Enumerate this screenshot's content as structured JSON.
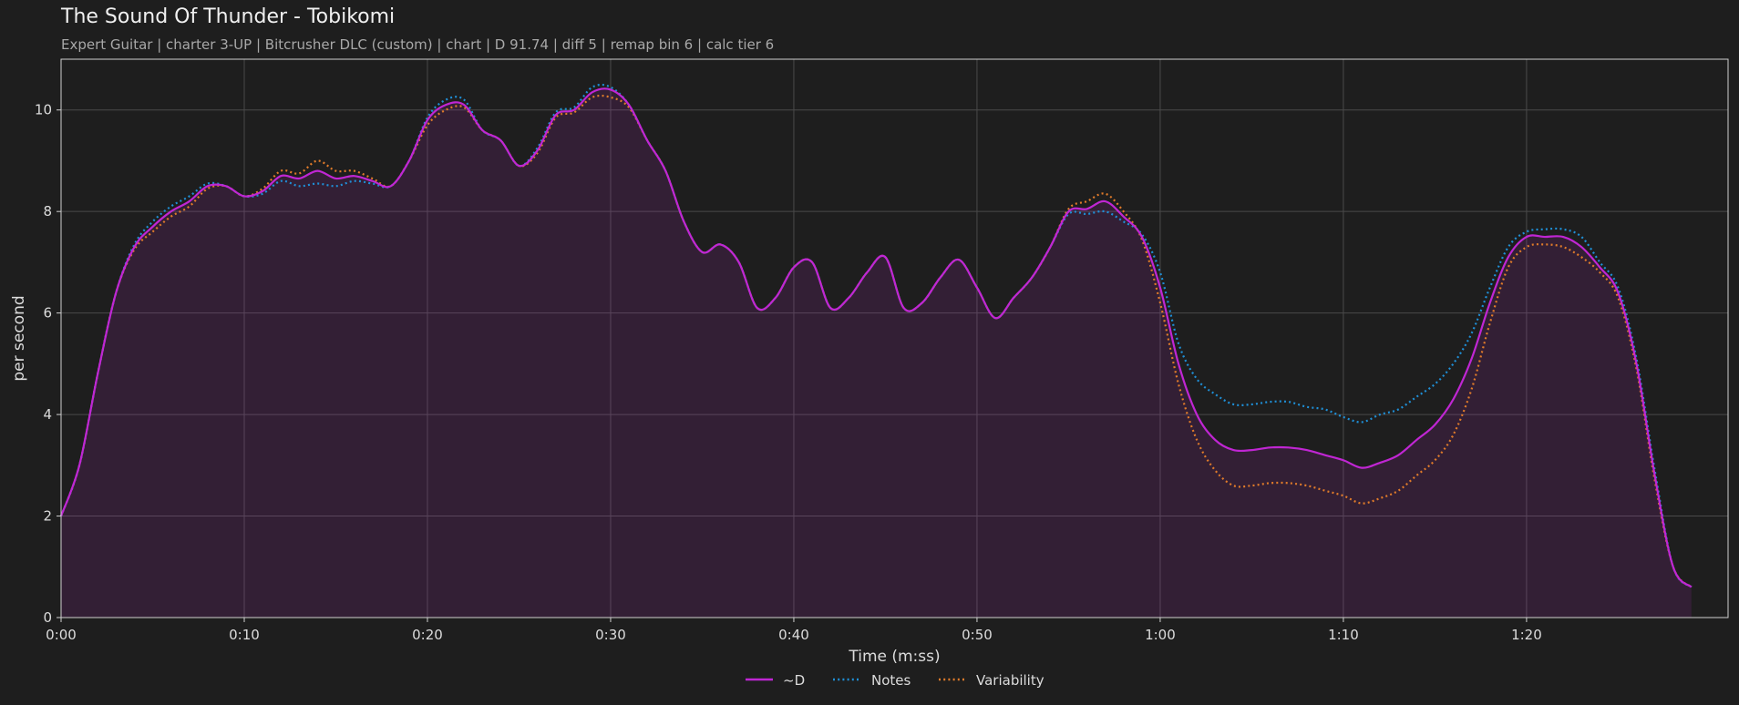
{
  "header": {
    "title": "The Sound Of Thunder - Tobikomi",
    "subtitle": "Expert Guitar  |  charter 3-UP  |  Bitcrusher DLC (custom)  |  chart  |  D 91.74  |  diff 5  |  remap bin 6  |  calc tier 6"
  },
  "chart_data": {
    "type": "line",
    "xlabel": "Time (m:ss)",
    "ylabel": "per second",
    "xlim": [
      0,
      91
    ],
    "ylim": [
      0,
      11
    ],
    "grid": true,
    "legend_position": "bottom-center",
    "x_ticks": [
      {
        "value": 0,
        "label": "0:00"
      },
      {
        "value": 10,
        "label": "0:10"
      },
      {
        "value": 20,
        "label": "0:20"
      },
      {
        "value": 30,
        "label": "0:30"
      },
      {
        "value": 40,
        "label": "0:40"
      },
      {
        "value": 50,
        "label": "0:50"
      },
      {
        "value": 60,
        "label": "1:00"
      },
      {
        "value": 70,
        "label": "1:10"
      },
      {
        "value": 80,
        "label": "1:20"
      }
    ],
    "y_ticks": [
      0,
      2,
      4,
      6,
      8,
      10
    ],
    "series": [
      {
        "name": "~D",
        "color": "#c026d3",
        "style": "solid",
        "fill": true,
        "points": [
          [
            0,
            2.0
          ],
          [
            1,
            3.0
          ],
          [
            2,
            4.8
          ],
          [
            3,
            6.4
          ],
          [
            4,
            7.3
          ],
          [
            5,
            7.7
          ],
          [
            6,
            8.0
          ],
          [
            7,
            8.2
          ],
          [
            8,
            8.5
          ],
          [
            9,
            8.5
          ],
          [
            10,
            8.3
          ],
          [
            11,
            8.4
          ],
          [
            12,
            8.7
          ],
          [
            13,
            8.65
          ],
          [
            14,
            8.8
          ],
          [
            15,
            8.65
          ],
          [
            16,
            8.7
          ],
          [
            17,
            8.6
          ],
          [
            18,
            8.5
          ],
          [
            19,
            9.0
          ],
          [
            20,
            9.8
          ],
          [
            21,
            10.1
          ],
          [
            22,
            10.1
          ],
          [
            23,
            9.6
          ],
          [
            24,
            9.4
          ],
          [
            25,
            8.9
          ],
          [
            26,
            9.2
          ],
          [
            27,
            9.9
          ],
          [
            28,
            10.0
          ],
          [
            29,
            10.35
          ],
          [
            30,
            10.4
          ],
          [
            31,
            10.1
          ],
          [
            32,
            9.4
          ],
          [
            33,
            8.8
          ],
          [
            34,
            7.8
          ],
          [
            35,
            7.2
          ],
          [
            36,
            7.35
          ],
          [
            37,
            7.0
          ],
          [
            38,
            6.1
          ],
          [
            39,
            6.3
          ],
          [
            40,
            6.9
          ],
          [
            41,
            7.0
          ],
          [
            42,
            6.1
          ],
          [
            43,
            6.3
          ],
          [
            44,
            6.8
          ],
          [
            45,
            7.1
          ],
          [
            46,
            6.1
          ],
          [
            47,
            6.2
          ],
          [
            48,
            6.7
          ],
          [
            49,
            7.05
          ],
          [
            50,
            6.5
          ],
          [
            51,
            5.9
          ],
          [
            52,
            6.3
          ],
          [
            53,
            6.7
          ],
          [
            54,
            7.3
          ],
          [
            55,
            8.0
          ],
          [
            56,
            8.05
          ],
          [
            57,
            8.2
          ],
          [
            58,
            7.9
          ],
          [
            59,
            7.5
          ],
          [
            60,
            6.5
          ],
          [
            61,
            5.0
          ],
          [
            62,
            4.0
          ],
          [
            63,
            3.5
          ],
          [
            64,
            3.3
          ],
          [
            65,
            3.3
          ],
          [
            66,
            3.35
          ],
          [
            67,
            3.35
          ],
          [
            68,
            3.3
          ],
          [
            69,
            3.2
          ],
          [
            70,
            3.1
          ],
          [
            71,
            2.95
          ],
          [
            72,
            3.05
          ],
          [
            73,
            3.2
          ],
          [
            74,
            3.5
          ],
          [
            75,
            3.8
          ],
          [
            76,
            4.3
          ],
          [
            77,
            5.1
          ],
          [
            78,
            6.2
          ],
          [
            79,
            7.1
          ],
          [
            80,
            7.5
          ],
          [
            81,
            7.5
          ],
          [
            82,
            7.5
          ],
          [
            83,
            7.3
          ],
          [
            84,
            6.9
          ],
          [
            85,
            6.4
          ],
          [
            86,
            5.0
          ],
          [
            87,
            2.8
          ],
          [
            88,
            1.0
          ],
          [
            89,
            0.6
          ]
        ]
      },
      {
        "name": "Notes",
        "color": "#1f8fd6",
        "style": "dotted",
        "fill": false,
        "points": [
          [
            0,
            2.0
          ],
          [
            1,
            3.0
          ],
          [
            2,
            4.8
          ],
          [
            3,
            6.4
          ],
          [
            4,
            7.35
          ],
          [
            5,
            7.8
          ],
          [
            6,
            8.1
          ],
          [
            7,
            8.3
          ],
          [
            8,
            8.55
          ],
          [
            9,
            8.5
          ],
          [
            10,
            8.3
          ],
          [
            11,
            8.35
          ],
          [
            12,
            8.6
          ],
          [
            13,
            8.5
          ],
          [
            14,
            8.55
          ],
          [
            15,
            8.5
          ],
          [
            16,
            8.6
          ],
          [
            17,
            8.55
          ],
          [
            18,
            8.5
          ],
          [
            19,
            9.0
          ],
          [
            20,
            9.85
          ],
          [
            21,
            10.2
          ],
          [
            22,
            10.2
          ],
          [
            23,
            9.6
          ],
          [
            24,
            9.4
          ],
          [
            25,
            8.9
          ],
          [
            26,
            9.25
          ],
          [
            27,
            9.95
          ],
          [
            28,
            10.05
          ],
          [
            29,
            10.45
          ],
          [
            30,
            10.45
          ],
          [
            31,
            10.1
          ],
          [
            32,
            9.4
          ],
          [
            33,
            8.8
          ],
          [
            34,
            7.8
          ],
          [
            35,
            7.2
          ],
          [
            36,
            7.35
          ],
          [
            37,
            7.0
          ],
          [
            38,
            6.1
          ],
          [
            39,
            6.3
          ],
          [
            40,
            6.9
          ],
          [
            41,
            7.0
          ],
          [
            42,
            6.1
          ],
          [
            43,
            6.3
          ],
          [
            44,
            6.8
          ],
          [
            45,
            7.1
          ],
          [
            46,
            6.1
          ],
          [
            47,
            6.2
          ],
          [
            48,
            6.7
          ],
          [
            49,
            7.05
          ],
          [
            50,
            6.5
          ],
          [
            51,
            5.9
          ],
          [
            52,
            6.3
          ],
          [
            53,
            6.7
          ],
          [
            54,
            7.3
          ],
          [
            55,
            7.95
          ],
          [
            56,
            7.95
          ],
          [
            57,
            8.0
          ],
          [
            58,
            7.8
          ],
          [
            59,
            7.55
          ],
          [
            60,
            6.8
          ],
          [
            61,
            5.4
          ],
          [
            62,
            4.7
          ],
          [
            63,
            4.4
          ],
          [
            64,
            4.2
          ],
          [
            65,
            4.2
          ],
          [
            66,
            4.25
          ],
          [
            67,
            4.25
          ],
          [
            68,
            4.15
          ],
          [
            69,
            4.1
          ],
          [
            70,
            3.95
          ],
          [
            71,
            3.85
          ],
          [
            72,
            4.0
          ],
          [
            73,
            4.1
          ],
          [
            74,
            4.35
          ],
          [
            75,
            4.6
          ],
          [
            76,
            5.0
          ],
          [
            77,
            5.6
          ],
          [
            78,
            6.5
          ],
          [
            79,
            7.3
          ],
          [
            80,
            7.6
          ],
          [
            81,
            7.65
          ],
          [
            82,
            7.65
          ],
          [
            83,
            7.5
          ],
          [
            84,
            7.0
          ],
          [
            85,
            6.5
          ],
          [
            86,
            5.1
          ],
          [
            87,
            2.9
          ],
          [
            88,
            1.0
          ],
          [
            89,
            0.6
          ]
        ]
      },
      {
        "name": "Variability",
        "color": "#e07b2a",
        "style": "dotted",
        "fill": false,
        "points": [
          [
            0,
            2.0
          ],
          [
            1,
            3.0
          ],
          [
            2,
            4.8
          ],
          [
            3,
            6.4
          ],
          [
            4,
            7.25
          ],
          [
            5,
            7.6
          ],
          [
            6,
            7.9
          ],
          [
            7,
            8.1
          ],
          [
            8,
            8.45
          ],
          [
            9,
            8.5
          ],
          [
            10,
            8.3
          ],
          [
            11,
            8.45
          ],
          [
            12,
            8.8
          ],
          [
            13,
            8.75
          ],
          [
            14,
            9.0
          ],
          [
            15,
            8.8
          ],
          [
            16,
            8.8
          ],
          [
            17,
            8.65
          ],
          [
            18,
            8.5
          ],
          [
            19,
            9.0
          ],
          [
            20,
            9.7
          ],
          [
            21,
            10.0
          ],
          [
            22,
            10.05
          ],
          [
            23,
            9.6
          ],
          [
            24,
            9.4
          ],
          [
            25,
            8.9
          ],
          [
            26,
            9.15
          ],
          [
            27,
            9.85
          ],
          [
            28,
            9.95
          ],
          [
            29,
            10.25
          ],
          [
            30,
            10.25
          ],
          [
            31,
            10.05
          ],
          [
            32,
            9.4
          ],
          [
            33,
            8.8
          ],
          [
            34,
            7.8
          ],
          [
            35,
            7.2
          ],
          [
            36,
            7.35
          ],
          [
            37,
            7.0
          ],
          [
            38,
            6.1
          ],
          [
            39,
            6.3
          ],
          [
            40,
            6.9
          ],
          [
            41,
            7.0
          ],
          [
            42,
            6.1
          ],
          [
            43,
            6.3
          ],
          [
            44,
            6.8
          ],
          [
            45,
            7.1
          ],
          [
            46,
            6.1
          ],
          [
            47,
            6.2
          ],
          [
            48,
            6.7
          ],
          [
            49,
            7.05
          ],
          [
            50,
            6.5
          ],
          [
            51,
            5.9
          ],
          [
            52,
            6.3
          ],
          [
            53,
            6.7
          ],
          [
            54,
            7.3
          ],
          [
            55,
            8.05
          ],
          [
            56,
            8.2
          ],
          [
            57,
            8.35
          ],
          [
            58,
            8.0
          ],
          [
            59,
            7.45
          ],
          [
            60,
            6.2
          ],
          [
            61,
            4.6
          ],
          [
            62,
            3.5
          ],
          [
            63,
            2.9
          ],
          [
            64,
            2.6
          ],
          [
            65,
            2.6
          ],
          [
            66,
            2.65
          ],
          [
            67,
            2.65
          ],
          [
            68,
            2.6
          ],
          [
            69,
            2.5
          ],
          [
            70,
            2.4
          ],
          [
            71,
            2.25
          ],
          [
            72,
            2.35
          ],
          [
            73,
            2.5
          ],
          [
            74,
            2.8
          ],
          [
            75,
            3.1
          ],
          [
            76,
            3.6
          ],
          [
            77,
            4.5
          ],
          [
            78,
            5.8
          ],
          [
            79,
            6.9
          ],
          [
            80,
            7.3
          ],
          [
            81,
            7.35
          ],
          [
            82,
            7.3
          ],
          [
            83,
            7.1
          ],
          [
            84,
            6.8
          ],
          [
            85,
            6.3
          ],
          [
            86,
            4.9
          ],
          [
            87,
            2.7
          ],
          [
            88,
            1.0
          ],
          [
            89,
            0.6
          ]
        ]
      }
    ]
  }
}
